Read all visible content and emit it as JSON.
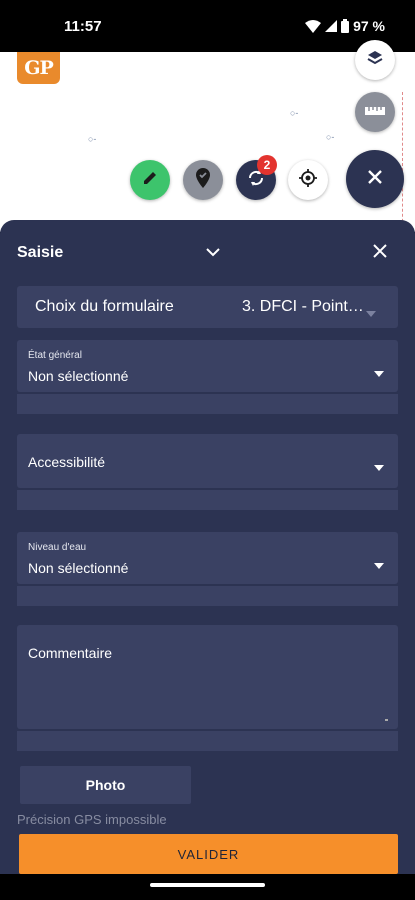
{
  "status_bar": {
    "time": "11:57",
    "battery": "97 %",
    "icons": [
      "wifi-icon",
      "cell-signal-icon",
      "battery-icon"
    ]
  },
  "map": {
    "logo_text": "GP",
    "buttons": [
      "layers-icon",
      "ruler-icon",
      "pencil-icon",
      "add-point-icon",
      "sync-icon",
      "locate-icon",
      "close-icon"
    ],
    "sync_badge": "2"
  },
  "panel": {
    "title": "Saisie",
    "form_select": {
      "label": "Choix du formulaire",
      "value": "3. DFCI - Point…"
    },
    "fields": [
      {
        "label": "État général",
        "value": "Non sélectionné"
      },
      {
        "label": "Accessibilité",
        "value": ""
      },
      {
        "label": "Niveau d'eau",
        "value": "Non sélectionné"
      }
    ],
    "comment_label": "Commentaire",
    "photo_label": "Photo",
    "gps_status": "Précision GPS impossible",
    "submit_label": "VALIDER"
  },
  "colors": {
    "panel_bg": "#2c3352",
    "field_bg": "#3a4163",
    "accent_orange": "#f68f2a",
    "edit_green": "#3dc46c",
    "badge_red": "#e3342f"
  }
}
